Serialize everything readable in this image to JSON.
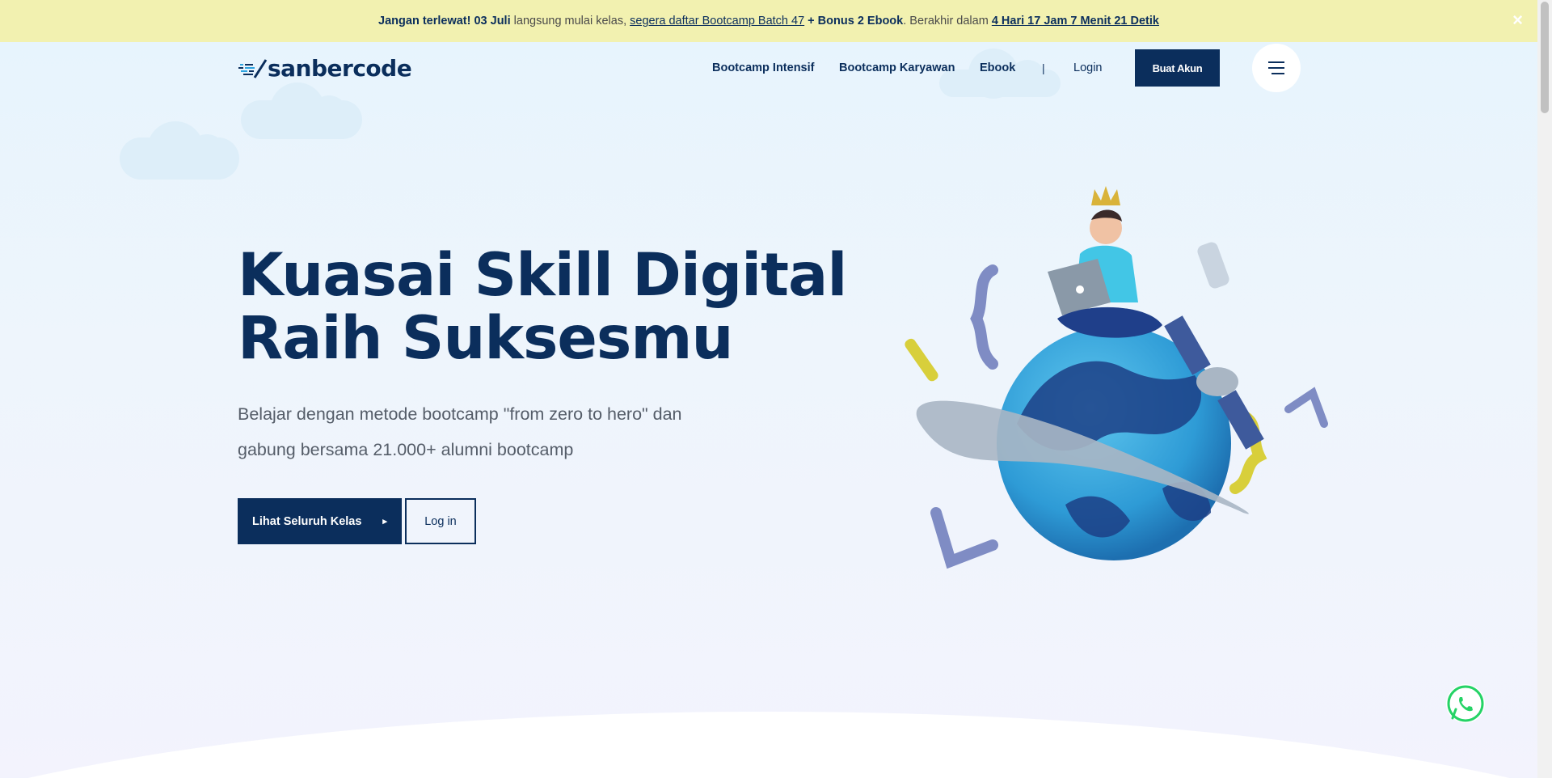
{
  "announcement": {
    "lead_bold": "Jangan terlewat! 03 Juli",
    "text_1": " langsung mulai kelas, ",
    "link": "segera daftar Bootcamp Batch 47",
    "bonus": " + Bonus 2 Ebook",
    "text_2": ". Berakhir dalam ",
    "countdown": "4 Hari 17 Jam 7 Menit 21 Detik",
    "close_symbol": "×"
  },
  "brand": {
    "logo_text": "sanbercode",
    "color": "#0b2e5c",
    "accent": "#2ba3e0"
  },
  "nav": {
    "items": [
      "Bootcamp Intensif",
      "Bootcamp Karyawan",
      "Ebook"
    ],
    "separator": "|",
    "login": "Login",
    "create_account": "Buat Akun",
    "menu_icon": "hamburger-icon"
  },
  "hero": {
    "title_line_1": "Kuasai Skill Digital",
    "title_line_2": "Raih Suksesmu",
    "subtitle_line_1": "Belajar dengan metode bootcamp \"from zero to hero\" dan",
    "subtitle_line_2": "gabung bersama 21.000+ alumni bootcamp",
    "primary_button": "Lihat Seluruh Kelas",
    "primary_icon": "▸",
    "secondary_button": "Log in"
  },
  "floating": {
    "whatsapp_icon": "whatsapp-icon",
    "whatsapp_color": "#25d366"
  },
  "colors": {
    "announce_bg": "#f2f1b0",
    "navy": "#0b2e5c"
  }
}
